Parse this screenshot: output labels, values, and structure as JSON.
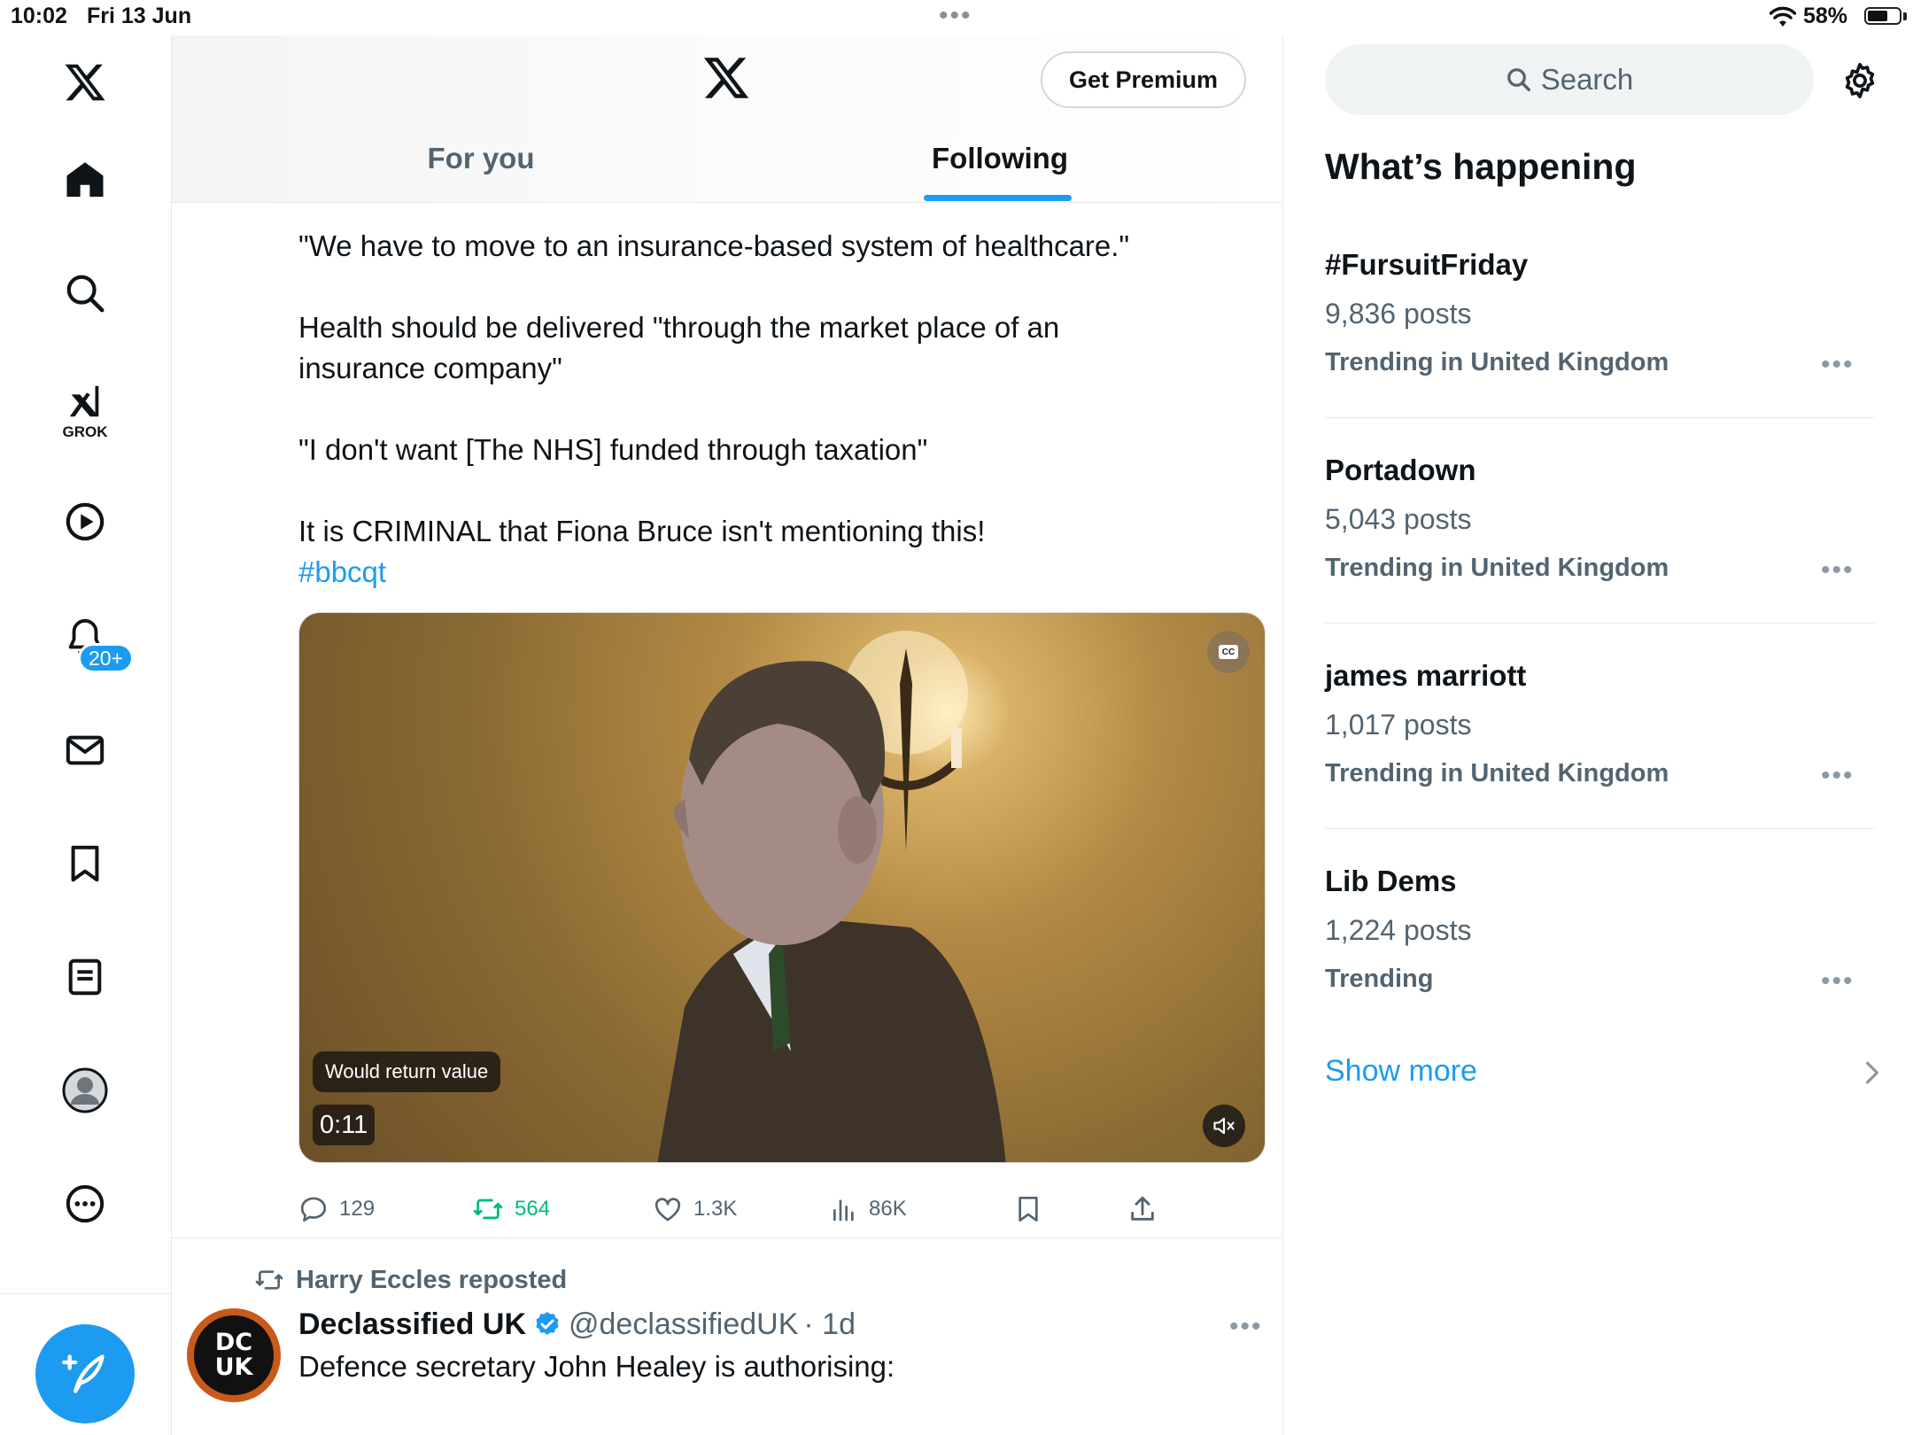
{
  "status_bar": {
    "time": "10:02",
    "date": "Fri 13 Jun",
    "battery_percent": "58%",
    "battery_level": 0.58
  },
  "nav": {
    "items": [
      {
        "name": "logo",
        "icon": "x-logo-icon"
      },
      {
        "name": "home",
        "icon": "home-icon"
      },
      {
        "name": "explore",
        "icon": "search-icon"
      },
      {
        "name": "grok",
        "icon": "grok-icon",
        "label": "GROK"
      },
      {
        "name": "video",
        "icon": "play-icon"
      },
      {
        "name": "notifications",
        "icon": "bell-icon",
        "badge": "20+"
      },
      {
        "name": "messages",
        "icon": "mail-icon"
      },
      {
        "name": "bookmarks",
        "icon": "bookmark-icon"
      },
      {
        "name": "lists",
        "icon": "list-icon"
      },
      {
        "name": "profile",
        "icon": "avatar-icon"
      },
      {
        "name": "more",
        "icon": "more-icon"
      }
    ],
    "compose_icon": "compose-icon"
  },
  "header": {
    "premium_label": "Get Premium",
    "tabs": [
      {
        "label": "For you",
        "active": false
      },
      {
        "label": "Following",
        "active": true
      }
    ]
  },
  "tweet1": {
    "lines": [
      "\"We have to move to an insurance-based system of healthcare.\"",
      "Health should be delivered \"through the market place of an insurance company\"",
      "\"I don't want [The NHS] funded through taxation\"",
      "It is CRIMINAL that Fiona Bruce isn't mentioning this!"
    ],
    "hashtag": "#bbcqt",
    "video": {
      "caption": "Would return value",
      "duration": "0:11",
      "cc_label": "CC"
    },
    "stats": {
      "replies": "129",
      "reposts": "564",
      "likes": "1.3K",
      "views": "86K"
    }
  },
  "tweet2": {
    "reposted_by": "Harry Eccles reposted",
    "name": "Declassified UK",
    "handle": "@declassifiedUK",
    "age": "· 1d",
    "avatar_text_top": "DC",
    "avatar_text_bottom": "UK",
    "body": "Defence secretary John Healey is authorising:"
  },
  "sidebar": {
    "search_placeholder": "Search",
    "title": "What’s happening",
    "trends": [
      {
        "name": "#FursuitFriday",
        "posts": "9,836 posts",
        "context": "Trending in United Kingdom"
      },
      {
        "name": "Portadown",
        "posts": "5,043 posts",
        "context": "Trending in United Kingdom"
      },
      {
        "name": "james marriott",
        "posts": "1,017 posts",
        "context": "Trending in United Kingdom"
      },
      {
        "name": "Lib Dems",
        "posts": "1,224 posts",
        "context": "Trending"
      }
    ],
    "show_more": "Show more"
  },
  "colors": {
    "accent": "#1d9bf0",
    "text_primary": "#0f1419",
    "text_secondary": "#536471",
    "repost_green": "#00ba7c",
    "border": "#e6e9ec"
  }
}
